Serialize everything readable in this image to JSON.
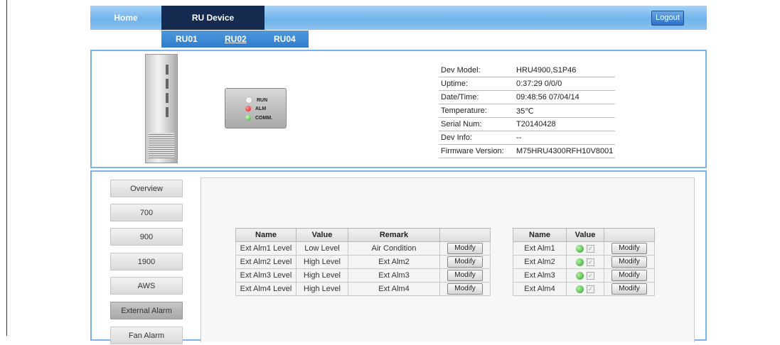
{
  "nav": {
    "home": "Home",
    "ru_device": "RU Device",
    "logout": "Logout"
  },
  "subnav": [
    "RU01",
    "RU02",
    "RU04"
  ],
  "leds": [
    "RUN",
    "ALM",
    "COMM."
  ],
  "device_info": [
    {
      "key": "Dev Model:",
      "value": "HRU4900,S1P46"
    },
    {
      "key": "Uptime:",
      "value": "0:37:29 0/0/0"
    },
    {
      "key": "Date/Time:",
      "value": "09:48:56 07/04/14"
    },
    {
      "key": "Temperature:",
      "value": "35℃"
    },
    {
      "key": "Serial Num:",
      "value": "T20140428"
    },
    {
      "key": "Dev Info:",
      "value": "--"
    },
    {
      "key": "Firmware Version:",
      "value": "M75HRU4300RFH10V8001"
    }
  ],
  "menu": [
    "Overview",
    "700",
    "900",
    "1900",
    "AWS",
    "External Alarm",
    "Fan Alarm"
  ],
  "level_table": {
    "headers": [
      "Name",
      "Value",
      "Remark",
      ""
    ],
    "rows": [
      {
        "name": "Ext Alm1 Level",
        "value": "Low Level",
        "remark": "Air Condition",
        "button": "Modify"
      },
      {
        "name": "Ext Alm2 Level",
        "value": "High Level",
        "remark": "Ext Alm2",
        "button": "Modify"
      },
      {
        "name": "Ext Alm3 Level",
        "value": "High Level",
        "remark": "Ext Alm3",
        "button": "Modify"
      },
      {
        "name": "Ext Alm4 Level",
        "value": "High Level",
        "remark": "Ext Alm4",
        "button": "Modify"
      }
    ]
  },
  "alarm_table": {
    "headers": [
      "Name",
      "Value",
      ""
    ],
    "rows": [
      {
        "name": "Ext Alm1",
        "status_color": "#28a128",
        "checked": true,
        "button": "Modify"
      },
      {
        "name": "Ext Alm2",
        "status_color": "#28a128",
        "checked": true,
        "button": "Modify"
      },
      {
        "name": "Ext Alm3",
        "status_color": "#28a128",
        "checked": true,
        "button": "Modify"
      },
      {
        "name": "Ext Alm4",
        "status_color": "#28a128",
        "checked": true,
        "button": "Modify"
      }
    ]
  },
  "colors": {
    "nav_active": "#142a4f",
    "panel_border": "#7ab3e6",
    "subnav": "#2f7ccd"
  }
}
